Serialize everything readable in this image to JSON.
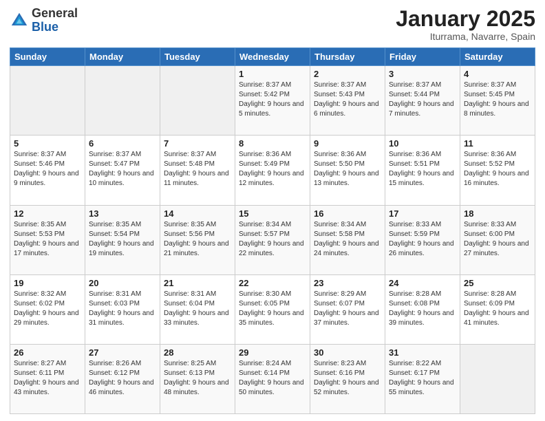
{
  "header": {
    "logo_general": "General",
    "logo_blue": "Blue",
    "month_title": "January 2025",
    "location": "Iturrama, Navarre, Spain"
  },
  "weekdays": [
    "Sunday",
    "Monday",
    "Tuesday",
    "Wednesday",
    "Thursday",
    "Friday",
    "Saturday"
  ],
  "weeks": [
    [
      {
        "day": "",
        "sunrise": "",
        "sunset": "",
        "daylight": ""
      },
      {
        "day": "",
        "sunrise": "",
        "sunset": "",
        "daylight": ""
      },
      {
        "day": "",
        "sunrise": "",
        "sunset": "",
        "daylight": ""
      },
      {
        "day": "1",
        "sunrise": "Sunrise: 8:37 AM",
        "sunset": "Sunset: 5:42 PM",
        "daylight": "Daylight: 9 hours and 5 minutes."
      },
      {
        "day": "2",
        "sunrise": "Sunrise: 8:37 AM",
        "sunset": "Sunset: 5:43 PM",
        "daylight": "Daylight: 9 hours and 6 minutes."
      },
      {
        "day": "3",
        "sunrise": "Sunrise: 8:37 AM",
        "sunset": "Sunset: 5:44 PM",
        "daylight": "Daylight: 9 hours and 7 minutes."
      },
      {
        "day": "4",
        "sunrise": "Sunrise: 8:37 AM",
        "sunset": "Sunset: 5:45 PM",
        "daylight": "Daylight: 9 hours and 8 minutes."
      }
    ],
    [
      {
        "day": "5",
        "sunrise": "Sunrise: 8:37 AM",
        "sunset": "Sunset: 5:46 PM",
        "daylight": "Daylight: 9 hours and 9 minutes."
      },
      {
        "day": "6",
        "sunrise": "Sunrise: 8:37 AM",
        "sunset": "Sunset: 5:47 PM",
        "daylight": "Daylight: 9 hours and 10 minutes."
      },
      {
        "day": "7",
        "sunrise": "Sunrise: 8:37 AM",
        "sunset": "Sunset: 5:48 PM",
        "daylight": "Daylight: 9 hours and 11 minutes."
      },
      {
        "day": "8",
        "sunrise": "Sunrise: 8:36 AM",
        "sunset": "Sunset: 5:49 PM",
        "daylight": "Daylight: 9 hours and 12 minutes."
      },
      {
        "day": "9",
        "sunrise": "Sunrise: 8:36 AM",
        "sunset": "Sunset: 5:50 PM",
        "daylight": "Daylight: 9 hours and 13 minutes."
      },
      {
        "day": "10",
        "sunrise": "Sunrise: 8:36 AM",
        "sunset": "Sunset: 5:51 PM",
        "daylight": "Daylight: 9 hours and 15 minutes."
      },
      {
        "day": "11",
        "sunrise": "Sunrise: 8:36 AM",
        "sunset": "Sunset: 5:52 PM",
        "daylight": "Daylight: 9 hours and 16 minutes."
      }
    ],
    [
      {
        "day": "12",
        "sunrise": "Sunrise: 8:35 AM",
        "sunset": "Sunset: 5:53 PM",
        "daylight": "Daylight: 9 hours and 17 minutes."
      },
      {
        "day": "13",
        "sunrise": "Sunrise: 8:35 AM",
        "sunset": "Sunset: 5:54 PM",
        "daylight": "Daylight: 9 hours and 19 minutes."
      },
      {
        "day": "14",
        "sunrise": "Sunrise: 8:35 AM",
        "sunset": "Sunset: 5:56 PM",
        "daylight": "Daylight: 9 hours and 21 minutes."
      },
      {
        "day": "15",
        "sunrise": "Sunrise: 8:34 AM",
        "sunset": "Sunset: 5:57 PM",
        "daylight": "Daylight: 9 hours and 22 minutes."
      },
      {
        "day": "16",
        "sunrise": "Sunrise: 8:34 AM",
        "sunset": "Sunset: 5:58 PM",
        "daylight": "Daylight: 9 hours and 24 minutes."
      },
      {
        "day": "17",
        "sunrise": "Sunrise: 8:33 AM",
        "sunset": "Sunset: 5:59 PM",
        "daylight": "Daylight: 9 hours and 26 minutes."
      },
      {
        "day": "18",
        "sunrise": "Sunrise: 8:33 AM",
        "sunset": "Sunset: 6:00 PM",
        "daylight": "Daylight: 9 hours and 27 minutes."
      }
    ],
    [
      {
        "day": "19",
        "sunrise": "Sunrise: 8:32 AM",
        "sunset": "Sunset: 6:02 PM",
        "daylight": "Daylight: 9 hours and 29 minutes."
      },
      {
        "day": "20",
        "sunrise": "Sunrise: 8:31 AM",
        "sunset": "Sunset: 6:03 PM",
        "daylight": "Daylight: 9 hours and 31 minutes."
      },
      {
        "day": "21",
        "sunrise": "Sunrise: 8:31 AM",
        "sunset": "Sunset: 6:04 PM",
        "daylight": "Daylight: 9 hours and 33 minutes."
      },
      {
        "day": "22",
        "sunrise": "Sunrise: 8:30 AM",
        "sunset": "Sunset: 6:05 PM",
        "daylight": "Daylight: 9 hours and 35 minutes."
      },
      {
        "day": "23",
        "sunrise": "Sunrise: 8:29 AM",
        "sunset": "Sunset: 6:07 PM",
        "daylight": "Daylight: 9 hours and 37 minutes."
      },
      {
        "day": "24",
        "sunrise": "Sunrise: 8:28 AM",
        "sunset": "Sunset: 6:08 PM",
        "daylight": "Daylight: 9 hours and 39 minutes."
      },
      {
        "day": "25",
        "sunrise": "Sunrise: 8:28 AM",
        "sunset": "Sunset: 6:09 PM",
        "daylight": "Daylight: 9 hours and 41 minutes."
      }
    ],
    [
      {
        "day": "26",
        "sunrise": "Sunrise: 8:27 AM",
        "sunset": "Sunset: 6:11 PM",
        "daylight": "Daylight: 9 hours and 43 minutes."
      },
      {
        "day": "27",
        "sunrise": "Sunrise: 8:26 AM",
        "sunset": "Sunset: 6:12 PM",
        "daylight": "Daylight: 9 hours and 46 minutes."
      },
      {
        "day": "28",
        "sunrise": "Sunrise: 8:25 AM",
        "sunset": "Sunset: 6:13 PM",
        "daylight": "Daylight: 9 hours and 48 minutes."
      },
      {
        "day": "29",
        "sunrise": "Sunrise: 8:24 AM",
        "sunset": "Sunset: 6:14 PM",
        "daylight": "Daylight: 9 hours and 50 minutes."
      },
      {
        "day": "30",
        "sunrise": "Sunrise: 8:23 AM",
        "sunset": "Sunset: 6:16 PM",
        "daylight": "Daylight: 9 hours and 52 minutes."
      },
      {
        "day": "31",
        "sunrise": "Sunrise: 8:22 AM",
        "sunset": "Sunset: 6:17 PM",
        "daylight": "Daylight: 9 hours and 55 minutes."
      },
      {
        "day": "",
        "sunrise": "",
        "sunset": "",
        "daylight": ""
      }
    ]
  ]
}
